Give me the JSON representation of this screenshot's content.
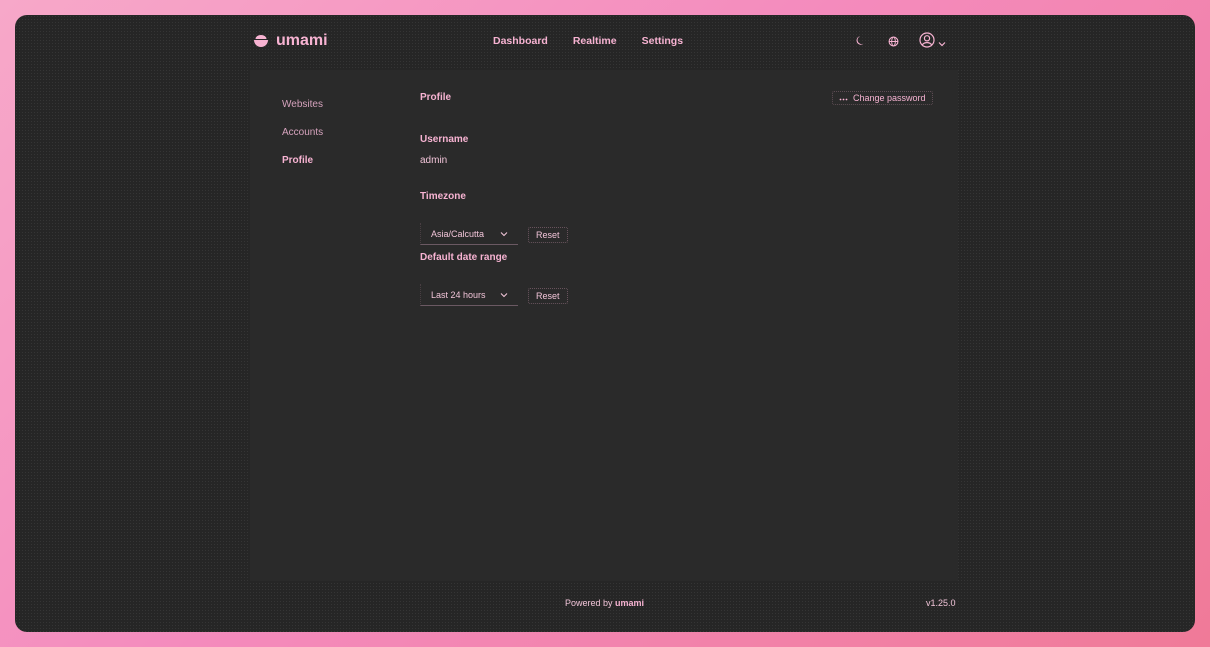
{
  "brand": {
    "name": "umami"
  },
  "nav": {
    "items": [
      {
        "label": "Dashboard"
      },
      {
        "label": "Realtime"
      },
      {
        "label": "Settings"
      }
    ],
    "icons": [
      "moon-icon",
      "globe-icon",
      "user-icon",
      "chevron-down-icon"
    ]
  },
  "sidebar": {
    "items": [
      {
        "label": "Websites",
        "active": false
      },
      {
        "label": "Accounts",
        "active": false
      },
      {
        "label": "Profile",
        "active": true
      }
    ]
  },
  "profile": {
    "title": "Profile",
    "change_password_label": "Change password",
    "username_label": "Username",
    "username_value": "admin",
    "timezone_label": "Timezone",
    "timezone_value": "Asia/Calcutta",
    "timezone_reset": "Reset",
    "date_range_label": "Default date range",
    "date_range_value": "Last 24 hours",
    "date_range_reset": "Reset"
  },
  "footer": {
    "powered_prefix": "Powered by",
    "powered_brand": "umami",
    "version": "v1.25.0"
  },
  "colors": {
    "accent": "#f7b3d2",
    "window_bg": "#262626",
    "panel_bg": "#2a2a2a",
    "frame": "#f48bbd"
  }
}
